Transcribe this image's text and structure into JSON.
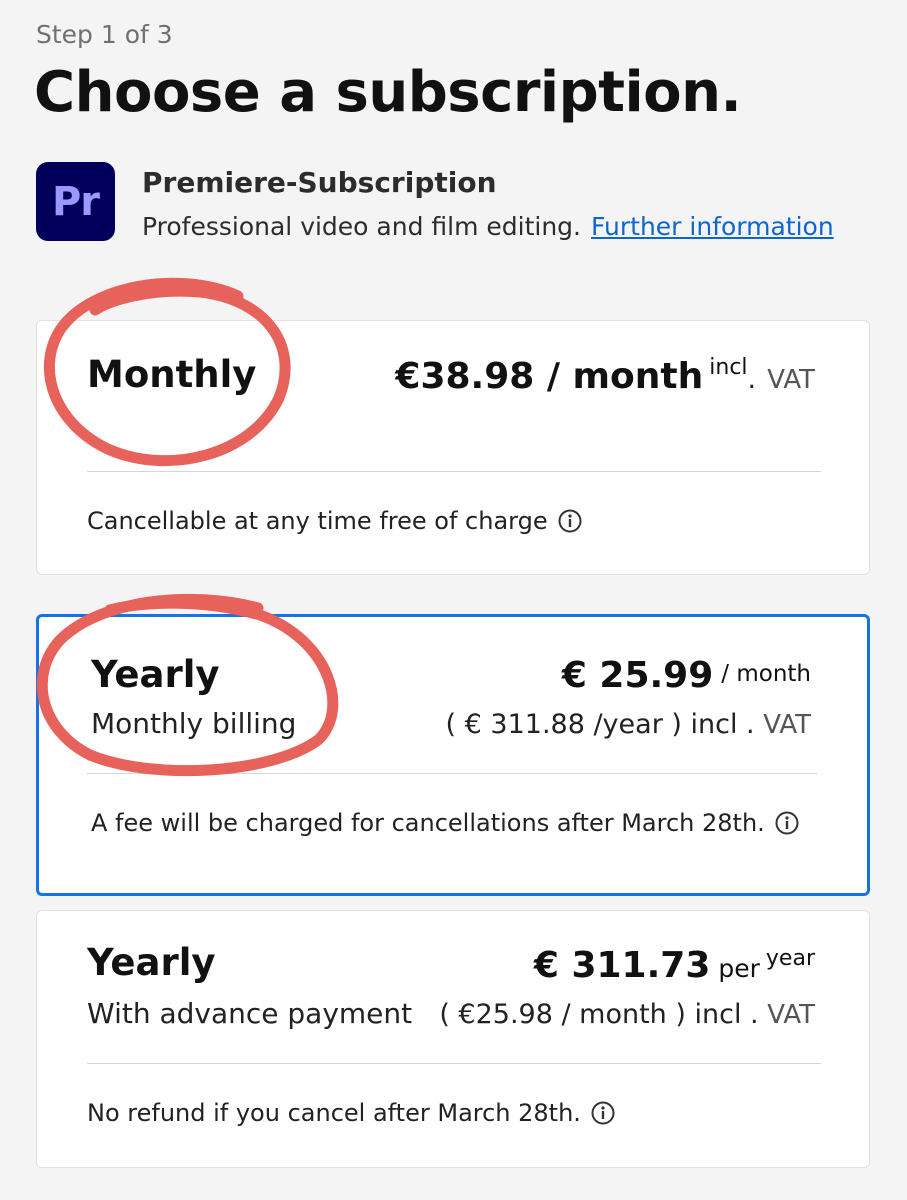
{
  "header": {
    "step": "Step 1 of 3",
    "title": "Choose a subscription."
  },
  "product": {
    "icon_text": "Pr",
    "icon_bg": "#00005b",
    "icon_fg": "#9999ff",
    "name": "Premiere-Subscription",
    "description": "Professional video and film editing.",
    "link": "Further information"
  },
  "plans": [
    {
      "name": "Monthly",
      "price": "€38.98 / month",
      "incl": "incl",
      "dot": ".",
      "vat": "VAT",
      "note": "Cancellable at any time free of charge",
      "selected": false
    },
    {
      "name": "Yearly",
      "subtitle": "Monthly billing",
      "price": "€ 25.99",
      "per": "/ month",
      "yearly_open": "( € 311.88 /year",
      "yearly_close": " ) incl .",
      "vat": "VAT",
      "note": "A fee will be charged for cancellations after March 28th.",
      "selected": true
    },
    {
      "name": "Yearly",
      "subtitle": "With advance payment",
      "price": "€ 311.73",
      "per": "per",
      "per_sup": "year",
      "monthly_open": "( €25.98 / month",
      "monthly_close": " )  incl .",
      "vat": "VAT",
      "note": "No refund if you cancel after March 28th.",
      "selected": false
    }
  ],
  "colors": {
    "accent": "#1473e6",
    "link": "#0d66d0",
    "annotation": "#e8625c"
  }
}
